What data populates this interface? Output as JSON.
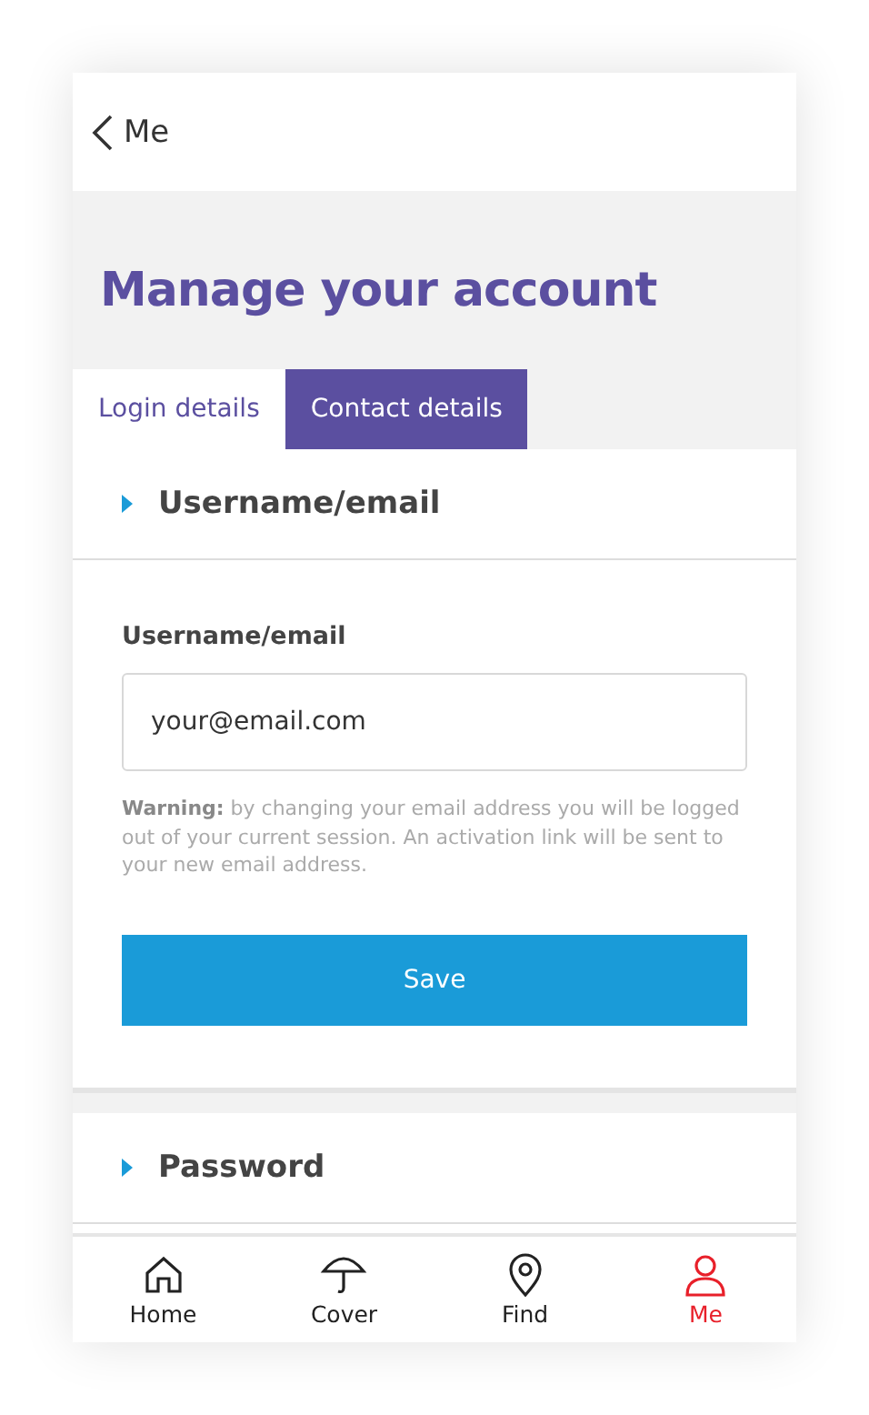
{
  "header": {
    "back_label": "Me"
  },
  "title": "Manage your account",
  "tabs": [
    {
      "label": "Login details",
      "selected": false
    },
    {
      "label": "Contact details",
      "selected": true
    }
  ],
  "username_section": {
    "title": "Username/email",
    "field_label": "Username/email",
    "value": "your@email.com",
    "warning": "**Warning:** by changing your email address you will be logged out of your current session. An activation link will be sent to your new email address.",
    "button": "Save"
  },
  "password_section": {
    "title": "Password"
  },
  "nav": [
    {
      "kind": "home",
      "label": "Home",
      "selected": false
    },
    {
      "kind": "cover",
      "label": "Cover",
      "selected": false
    },
    {
      "kind": "find",
      "label": "Find",
      "selected": false
    },
    {
      "kind": "me",
      "label": "Me",
      "selected": true
    }
  ]
}
